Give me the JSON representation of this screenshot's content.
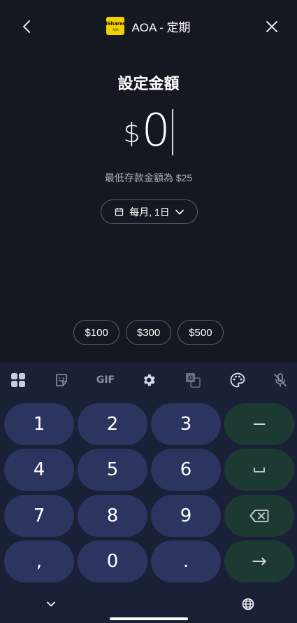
{
  "header": {
    "title": "AOA - 定期",
    "logo_brand": "iShares",
    "logo_ticker": "AOA"
  },
  "heading": "設定金額",
  "amount": {
    "currency": "$",
    "value": "0"
  },
  "min_text": "最低存款金額為 $25",
  "frequency": {
    "label": "每月, 1日",
    "icon": "calendar-icon"
  },
  "presets": [
    "$100",
    "$300",
    "$500"
  ],
  "keyboard": {
    "toolbar": [
      {
        "name": "apps-grid-icon"
      },
      {
        "name": "sticker-icon"
      },
      {
        "name": "gif-icon",
        "label": "GIF"
      },
      {
        "name": "gear-icon"
      },
      {
        "name": "translate-icon"
      },
      {
        "name": "palette-icon"
      },
      {
        "name": "mic-off-icon"
      }
    ],
    "keys": [
      "1",
      "2",
      "3",
      "4",
      "5",
      "6",
      "7",
      "8",
      "9",
      ",",
      "0",
      "."
    ],
    "fn_keys": {
      "minus": "−",
      "space": "␣",
      "backspace": "backspace-icon",
      "enter": "→"
    }
  },
  "colors": {
    "background": "#141821",
    "keyboard": "#1a2036",
    "key": "#2b3560",
    "fn_key": "#1c3a32",
    "logo": "#f2d000"
  }
}
